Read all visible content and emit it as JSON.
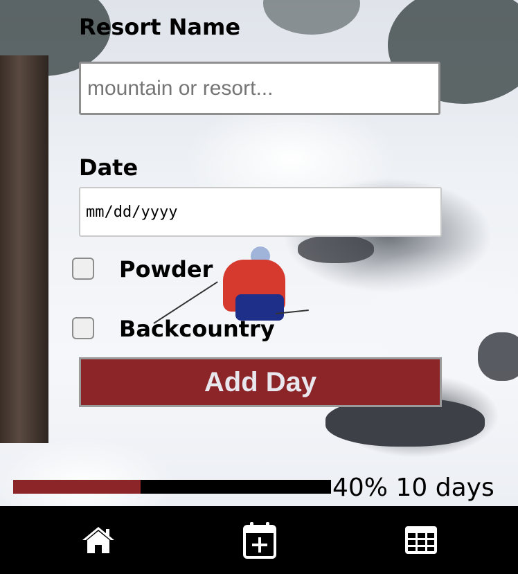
{
  "form": {
    "resort_label": "Resort Name",
    "resort_placeholder": "mountain or resort...",
    "resort_value": "",
    "date_label": "Date",
    "date_placeholder": "mm/dd/yyyy",
    "powder_label": "Powder",
    "powder_checked": false,
    "backcountry_label": "Backcountry",
    "backcountry_checked": false,
    "add_button_label": "Add Day"
  },
  "progress": {
    "fraction": 0.4,
    "percent_text": "40%",
    "days_text": "10 days"
  },
  "nav": {
    "items": [
      {
        "icon": "home-icon"
      },
      {
        "icon": "calendar-plus-icon"
      },
      {
        "icon": "grid-table-icon"
      }
    ]
  },
  "colors": {
    "accent": "#8b2528",
    "nav_bg": "#000000",
    "nav_icon": "#ffffff"
  }
}
